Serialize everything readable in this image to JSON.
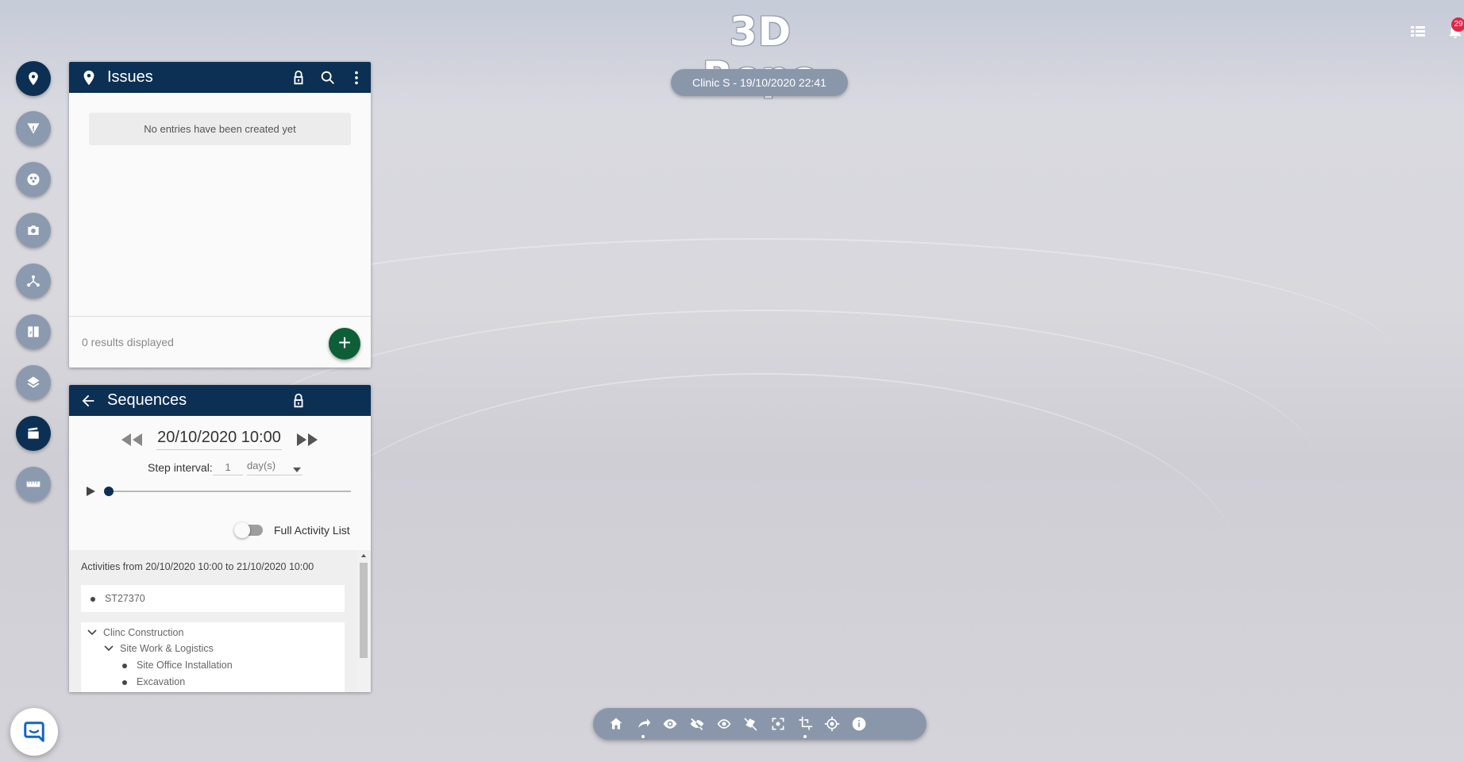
{
  "app": {
    "logo_text": "3D Repo",
    "model_label": "Clinic S - 19/10/2020 22:41",
    "notifications_count": "29"
  },
  "nav": {
    "items": [
      {
        "name": "issues",
        "icon": "map-pin-icon",
        "active": true
      },
      {
        "name": "risks",
        "icon": "warning-icon",
        "active": false
      },
      {
        "name": "groups",
        "icon": "groups-icon",
        "active": false
      },
      {
        "name": "views",
        "icon": "camera-icon",
        "active": false
      },
      {
        "name": "tree",
        "icon": "tree-icon",
        "active": false
      },
      {
        "name": "compare",
        "icon": "compare-icon",
        "active": false
      },
      {
        "name": "gis",
        "icon": "layers-icon",
        "active": false
      },
      {
        "name": "sequences",
        "icon": "clapperboard-icon",
        "active": true
      },
      {
        "name": "measure",
        "icon": "ruler-icon",
        "active": false
      }
    ]
  },
  "issues_panel": {
    "title": "Issues",
    "empty_message": "No entries have been created yet",
    "results_text": "0 results displayed",
    "add_label": "+"
  },
  "sequences_panel": {
    "title": "Sequences",
    "date": "20/10/2020 10:00",
    "step_interval_label": "Step interval:",
    "step_value": "1",
    "step_unit": "day(s)",
    "full_activity_label": "Full Activity List",
    "full_activity_on": false,
    "activities_header": "Activities from 20/10/2020 10:00 to 21/10/2020 10:00",
    "activity_single": "ST27370",
    "tree": {
      "root": "Clinc Construction",
      "child": "Site Work & Logistics",
      "leaf1": "Site Office Installation",
      "leaf2": "Excavation"
    }
  },
  "toolbar": {
    "buttons": [
      "home-icon",
      "navigation-mode-icon",
      "show-all-icon",
      "hide-icon",
      "isolate-icon",
      "clip-icon",
      "focus-icon",
      "crop-icon",
      "target-icon",
      "info-icon"
    ]
  },
  "colors": {
    "header": "#0c2f54",
    "nav": "#8c9ab0",
    "add_button": "#0e5f37",
    "badge": "#e0264a"
  }
}
